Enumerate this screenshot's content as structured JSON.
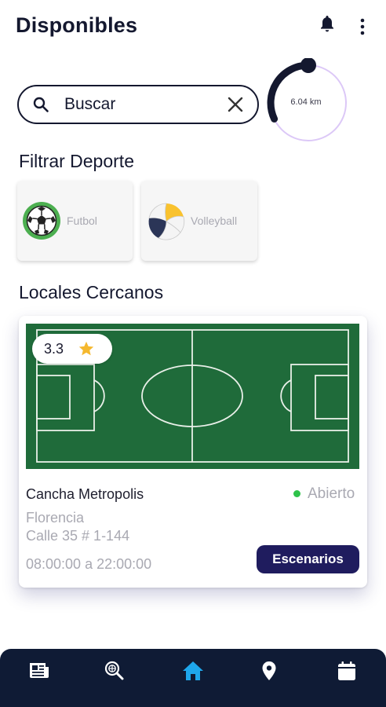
{
  "header": {
    "title": "Disponibles",
    "icons": [
      "bell-icon",
      "more-vert-icon"
    ]
  },
  "search": {
    "placeholder": "Buscar",
    "value": "Buscar"
  },
  "distance": {
    "label": "6.04 km",
    "fraction": 0.32
  },
  "filter": {
    "title": "Filtrar Deporte",
    "sports": [
      {
        "label": "Futbol",
        "icon": "soccer-ball-icon"
      },
      {
        "label": "Volleyball",
        "icon": "volleyball-icon"
      }
    ]
  },
  "nearby": {
    "title": "Locales Cercanos",
    "venues": [
      {
        "rating": "3.3",
        "name": "Cancha Metropolis",
        "status": "Abierto",
        "city": "Florencia",
        "address": "Calle 35 # 1-144",
        "hours": "08:00:00 a 22:00:00",
        "button": "Escenarios"
      }
    ]
  },
  "nav": {
    "items": [
      "news-icon",
      "search-sport-icon",
      "home-icon",
      "location-icon",
      "calendar-icon"
    ],
    "active": "home-icon"
  },
  "colors": {
    "primary": "#14182f",
    "button": "#1f1c5e",
    "nav_bg": "#0f1b35",
    "nav_active": "#1ea7ec",
    "field_green": "#1f6b3a",
    "open_green": "#2ec24a",
    "dial_track": "#d9c6f5"
  }
}
